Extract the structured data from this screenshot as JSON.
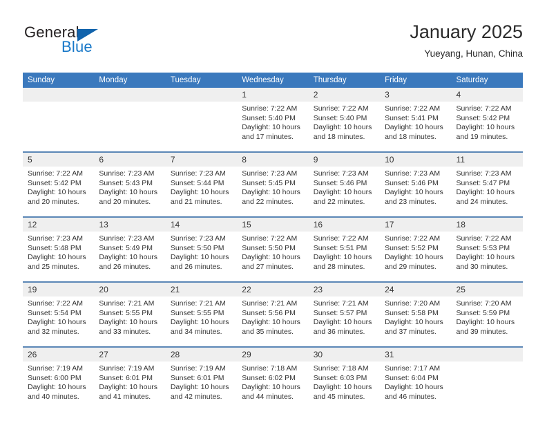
{
  "logo": {
    "word_top": "General",
    "word_bottom": "Blue",
    "triangle_color": "#1163ac",
    "blue_color": "#1878c8"
  },
  "header": {
    "title": "January 2025",
    "subtitle": "Yueyang, Hunan, China"
  },
  "colors": {
    "header_bg": "#3b79bd",
    "daynum_bg": "#efefef",
    "week_separator": "#5b87b6",
    "text": "#333333"
  },
  "weekday_headers": [
    "Sunday",
    "Monday",
    "Tuesday",
    "Wednesday",
    "Thursday",
    "Friday",
    "Saturday"
  ],
  "weeks": [
    {
      "days": [
        {
          "num": "",
          "sunrise": "",
          "sunset": "",
          "daylight_1": "",
          "daylight_2": ""
        },
        {
          "num": "",
          "sunrise": "",
          "sunset": "",
          "daylight_1": "",
          "daylight_2": ""
        },
        {
          "num": "",
          "sunrise": "",
          "sunset": "",
          "daylight_1": "",
          "daylight_2": ""
        },
        {
          "num": "1",
          "sunrise": "Sunrise: 7:22 AM",
          "sunset": "Sunset: 5:40 PM",
          "daylight_1": "Daylight: 10 hours",
          "daylight_2": "and 17 minutes."
        },
        {
          "num": "2",
          "sunrise": "Sunrise: 7:22 AM",
          "sunset": "Sunset: 5:40 PM",
          "daylight_1": "Daylight: 10 hours",
          "daylight_2": "and 18 minutes."
        },
        {
          "num": "3",
          "sunrise": "Sunrise: 7:22 AM",
          "sunset": "Sunset: 5:41 PM",
          "daylight_1": "Daylight: 10 hours",
          "daylight_2": "and 18 minutes."
        },
        {
          "num": "4",
          "sunrise": "Sunrise: 7:22 AM",
          "sunset": "Sunset: 5:42 PM",
          "daylight_1": "Daylight: 10 hours",
          "daylight_2": "and 19 minutes."
        }
      ]
    },
    {
      "days": [
        {
          "num": "5",
          "sunrise": "Sunrise: 7:22 AM",
          "sunset": "Sunset: 5:42 PM",
          "daylight_1": "Daylight: 10 hours",
          "daylight_2": "and 20 minutes."
        },
        {
          "num": "6",
          "sunrise": "Sunrise: 7:23 AM",
          "sunset": "Sunset: 5:43 PM",
          "daylight_1": "Daylight: 10 hours",
          "daylight_2": "and 20 minutes."
        },
        {
          "num": "7",
          "sunrise": "Sunrise: 7:23 AM",
          "sunset": "Sunset: 5:44 PM",
          "daylight_1": "Daylight: 10 hours",
          "daylight_2": "and 21 minutes."
        },
        {
          "num": "8",
          "sunrise": "Sunrise: 7:23 AM",
          "sunset": "Sunset: 5:45 PM",
          "daylight_1": "Daylight: 10 hours",
          "daylight_2": "and 22 minutes."
        },
        {
          "num": "9",
          "sunrise": "Sunrise: 7:23 AM",
          "sunset": "Sunset: 5:46 PM",
          "daylight_1": "Daylight: 10 hours",
          "daylight_2": "and 22 minutes."
        },
        {
          "num": "10",
          "sunrise": "Sunrise: 7:23 AM",
          "sunset": "Sunset: 5:46 PM",
          "daylight_1": "Daylight: 10 hours",
          "daylight_2": "and 23 minutes."
        },
        {
          "num": "11",
          "sunrise": "Sunrise: 7:23 AM",
          "sunset": "Sunset: 5:47 PM",
          "daylight_1": "Daylight: 10 hours",
          "daylight_2": "and 24 minutes."
        }
      ]
    },
    {
      "days": [
        {
          "num": "12",
          "sunrise": "Sunrise: 7:23 AM",
          "sunset": "Sunset: 5:48 PM",
          "daylight_1": "Daylight: 10 hours",
          "daylight_2": "and 25 minutes."
        },
        {
          "num": "13",
          "sunrise": "Sunrise: 7:23 AM",
          "sunset": "Sunset: 5:49 PM",
          "daylight_1": "Daylight: 10 hours",
          "daylight_2": "and 26 minutes."
        },
        {
          "num": "14",
          "sunrise": "Sunrise: 7:23 AM",
          "sunset": "Sunset: 5:50 PM",
          "daylight_1": "Daylight: 10 hours",
          "daylight_2": "and 26 minutes."
        },
        {
          "num": "15",
          "sunrise": "Sunrise: 7:22 AM",
          "sunset": "Sunset: 5:50 PM",
          "daylight_1": "Daylight: 10 hours",
          "daylight_2": "and 27 minutes."
        },
        {
          "num": "16",
          "sunrise": "Sunrise: 7:22 AM",
          "sunset": "Sunset: 5:51 PM",
          "daylight_1": "Daylight: 10 hours",
          "daylight_2": "and 28 minutes."
        },
        {
          "num": "17",
          "sunrise": "Sunrise: 7:22 AM",
          "sunset": "Sunset: 5:52 PM",
          "daylight_1": "Daylight: 10 hours",
          "daylight_2": "and 29 minutes."
        },
        {
          "num": "18",
          "sunrise": "Sunrise: 7:22 AM",
          "sunset": "Sunset: 5:53 PM",
          "daylight_1": "Daylight: 10 hours",
          "daylight_2": "and 30 minutes."
        }
      ]
    },
    {
      "days": [
        {
          "num": "19",
          "sunrise": "Sunrise: 7:22 AM",
          "sunset": "Sunset: 5:54 PM",
          "daylight_1": "Daylight: 10 hours",
          "daylight_2": "and 32 minutes."
        },
        {
          "num": "20",
          "sunrise": "Sunrise: 7:21 AM",
          "sunset": "Sunset: 5:55 PM",
          "daylight_1": "Daylight: 10 hours",
          "daylight_2": "and 33 minutes."
        },
        {
          "num": "21",
          "sunrise": "Sunrise: 7:21 AM",
          "sunset": "Sunset: 5:55 PM",
          "daylight_1": "Daylight: 10 hours",
          "daylight_2": "and 34 minutes."
        },
        {
          "num": "22",
          "sunrise": "Sunrise: 7:21 AM",
          "sunset": "Sunset: 5:56 PM",
          "daylight_1": "Daylight: 10 hours",
          "daylight_2": "and 35 minutes."
        },
        {
          "num": "23",
          "sunrise": "Sunrise: 7:21 AM",
          "sunset": "Sunset: 5:57 PM",
          "daylight_1": "Daylight: 10 hours",
          "daylight_2": "and 36 minutes."
        },
        {
          "num": "24",
          "sunrise": "Sunrise: 7:20 AM",
          "sunset": "Sunset: 5:58 PM",
          "daylight_1": "Daylight: 10 hours",
          "daylight_2": "and 37 minutes."
        },
        {
          "num": "25",
          "sunrise": "Sunrise: 7:20 AM",
          "sunset": "Sunset: 5:59 PM",
          "daylight_1": "Daylight: 10 hours",
          "daylight_2": "and 39 minutes."
        }
      ]
    },
    {
      "days": [
        {
          "num": "26",
          "sunrise": "Sunrise: 7:19 AM",
          "sunset": "Sunset: 6:00 PM",
          "daylight_1": "Daylight: 10 hours",
          "daylight_2": "and 40 minutes."
        },
        {
          "num": "27",
          "sunrise": "Sunrise: 7:19 AM",
          "sunset": "Sunset: 6:01 PM",
          "daylight_1": "Daylight: 10 hours",
          "daylight_2": "and 41 minutes."
        },
        {
          "num": "28",
          "sunrise": "Sunrise: 7:19 AM",
          "sunset": "Sunset: 6:01 PM",
          "daylight_1": "Daylight: 10 hours",
          "daylight_2": "and 42 minutes."
        },
        {
          "num": "29",
          "sunrise": "Sunrise: 7:18 AM",
          "sunset": "Sunset: 6:02 PM",
          "daylight_1": "Daylight: 10 hours",
          "daylight_2": "and 44 minutes."
        },
        {
          "num": "30",
          "sunrise": "Sunrise: 7:18 AM",
          "sunset": "Sunset: 6:03 PM",
          "daylight_1": "Daylight: 10 hours",
          "daylight_2": "and 45 minutes."
        },
        {
          "num": "31",
          "sunrise": "Sunrise: 7:17 AM",
          "sunset": "Sunset: 6:04 PM",
          "daylight_1": "Daylight: 10 hours",
          "daylight_2": "and 46 minutes."
        },
        {
          "num": "",
          "sunrise": "",
          "sunset": "",
          "daylight_1": "",
          "daylight_2": ""
        }
      ]
    }
  ]
}
